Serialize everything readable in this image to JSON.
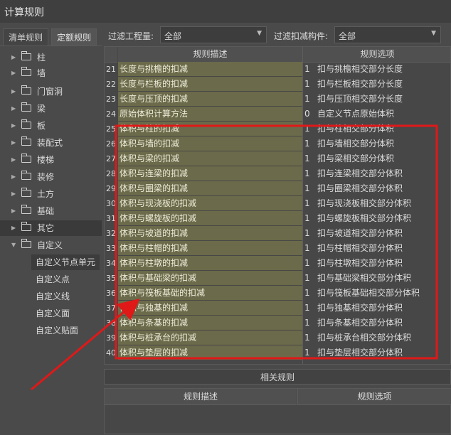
{
  "window": {
    "title": "计算规则"
  },
  "tabs": [
    {
      "label": "清单规则"
    },
    {
      "label": "定额规则"
    }
  ],
  "filters": {
    "project_label": "过滤工程量:",
    "project_value": "全部",
    "component_label": "过滤扣减构件:",
    "component_value": "全部"
  },
  "tree": {
    "items": [
      {
        "label": "柱"
      },
      {
        "label": "墙"
      },
      {
        "label": "门窗洞"
      },
      {
        "label": "梁"
      },
      {
        "label": "板"
      },
      {
        "label": "装配式"
      },
      {
        "label": "楼梯"
      },
      {
        "label": "装修"
      },
      {
        "label": "土方"
      },
      {
        "label": "基础"
      },
      {
        "label": "其它"
      },
      {
        "label": "自定义"
      }
    ],
    "sub_items": [
      {
        "label": "自定义节点单元"
      },
      {
        "label": "自定义点"
      },
      {
        "label": "自定义线"
      },
      {
        "label": "自定义面"
      },
      {
        "label": "自定义贴面"
      }
    ]
  },
  "grid": {
    "columns": [
      "规则描述",
      "规则选项"
    ],
    "rows": [
      {
        "n": "21",
        "desc": "长度与挑檐的扣减",
        "code": "1",
        "option": "扣与挑檐相交部分长度"
      },
      {
        "n": "22",
        "desc": "长度与栏板的扣减",
        "code": "1",
        "option": "扣与栏板相交部分长度"
      },
      {
        "n": "23",
        "desc": "长度与压顶的扣减",
        "code": "1",
        "option": "扣与压顶相交部分长度"
      },
      {
        "n": "24",
        "desc": "原始体积计算方法",
        "code": "0",
        "option": "自定义节点原始体积"
      },
      {
        "n": "25",
        "desc": "体积与柱的扣减",
        "code": "1",
        "option": "扣与柱相交部分体积"
      },
      {
        "n": "26",
        "desc": "体积与墙的扣减",
        "code": "1",
        "option": "扣与墙相交部分体积"
      },
      {
        "n": "27",
        "desc": "体积与梁的扣减",
        "code": "1",
        "option": "扣与梁相交部分体积"
      },
      {
        "n": "28",
        "desc": "体积与连梁的扣减",
        "code": "1",
        "option": "扣与连梁相交部分体积"
      },
      {
        "n": "29",
        "desc": "体积与圈梁的扣减",
        "code": "1",
        "option": "扣与圈梁相交部分体积"
      },
      {
        "n": "30",
        "desc": "体积与现浇板的扣减",
        "code": "1",
        "option": "扣与现浇板相交部分体积"
      },
      {
        "n": "31",
        "desc": "体积与螺旋板的扣减",
        "code": "1",
        "option": "扣与螺旋板相交部分体积"
      },
      {
        "n": "32",
        "desc": "体积与坡道的扣减",
        "code": "1",
        "option": "扣与坡道相交部分体积"
      },
      {
        "n": "33",
        "desc": "体积与柱帽的扣减",
        "code": "1",
        "option": "扣与柱帽相交部分体积"
      },
      {
        "n": "34",
        "desc": "体积与柱墩的扣减",
        "code": "1",
        "option": "扣与柱墩相交部分体积"
      },
      {
        "n": "35",
        "desc": "体积与基础梁的扣减",
        "code": "1",
        "option": "扣与基础梁相交部分体积"
      },
      {
        "n": "36",
        "desc": "体积与筏板基础的扣减",
        "code": "1",
        "option": "扣与筏板基础相交部分体积"
      },
      {
        "n": "37",
        "desc": "体积与独基的扣减",
        "code": "1",
        "option": "扣与独基相交部分体积"
      },
      {
        "n": "38",
        "desc": "体积与条基的扣减",
        "code": "1",
        "option": "扣与条基相交部分体积"
      },
      {
        "n": "39",
        "desc": "体积与桩承台的扣减",
        "code": "1",
        "option": "扣与桩承台相交部分体积"
      },
      {
        "n": "40",
        "desc": "体积与垫层的扣减",
        "code": "1",
        "option": "扣与垫层相交部分体积"
      }
    ]
  },
  "related": {
    "button_label": "相关规则",
    "columns": [
      "规则描述",
      "规则选项"
    ]
  },
  "colors": {
    "highlight": "#e01818",
    "desc_cell": "#6b6a4a"
  },
  "icons": {
    "tree_expand": "triangle-right",
    "tree_collapse": "triangle-down",
    "folder": "folder-icon"
  }
}
